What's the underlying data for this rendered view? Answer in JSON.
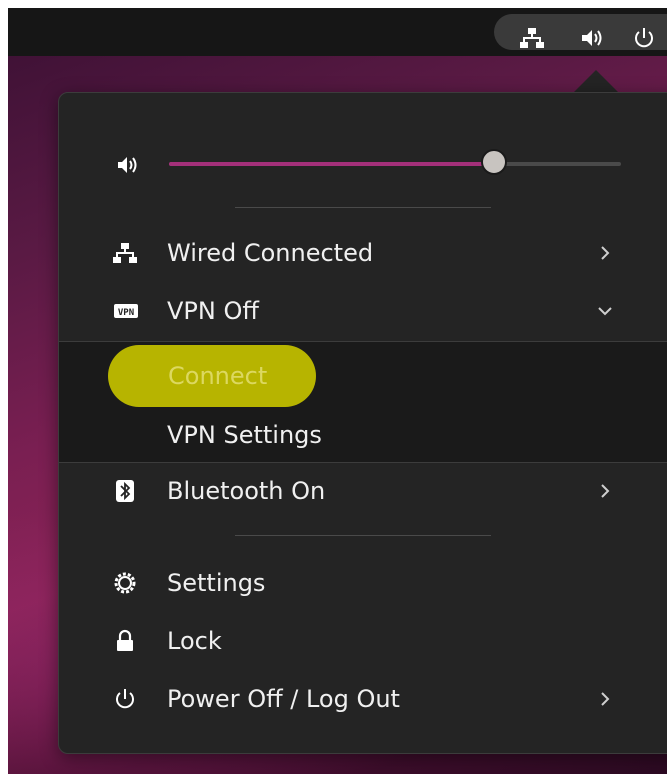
{
  "topbar": {
    "indicators": [
      {
        "icon": "network-wired-icon"
      },
      {
        "icon": "speaker-icon"
      },
      {
        "icon": "power-icon"
      }
    ]
  },
  "menu": {
    "volume": {
      "icon": "speaker-icon",
      "level_percent": 72
    },
    "items": [
      {
        "label": "Wired Connected",
        "icon": "network-wired-icon",
        "has_submenu": true
      },
      {
        "label": "VPN Off",
        "icon": "vpn-icon",
        "expanded": true
      }
    ],
    "vpn_submenu": {
      "connect_label": "Connect",
      "settings_label": "VPN Settings"
    },
    "bluetooth": {
      "label": "Bluetooth On",
      "icon": "bluetooth-icon",
      "has_submenu": true
    },
    "system": [
      {
        "label": "Settings",
        "icon": "settings-gear-icon"
      },
      {
        "label": "Lock",
        "icon": "lock-icon"
      },
      {
        "label": "Power Off / Log Out",
        "icon": "power-icon",
        "has_submenu": true
      }
    ]
  },
  "colors": {
    "accent": "#a4307a",
    "highlight": "#b7b400",
    "menu_bg": "#242424",
    "topbar_bg": "#161616"
  }
}
